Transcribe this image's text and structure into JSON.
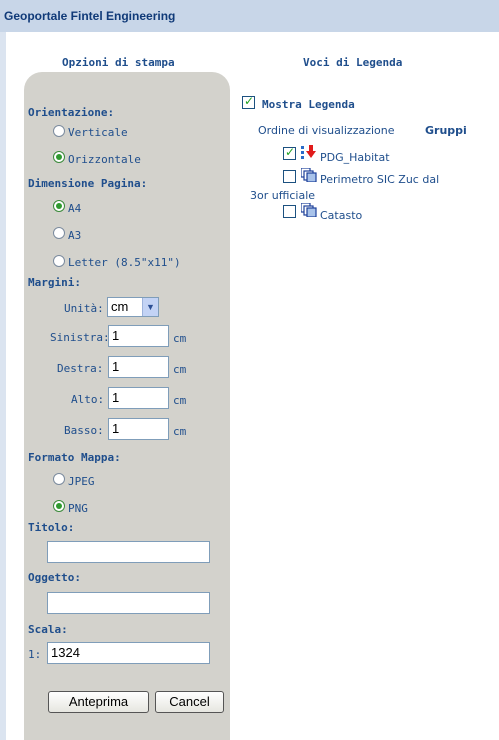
{
  "title": "Geoportale Fintel Engineering",
  "left_heading": "Opzioni di stampa",
  "right_heading": "Voci di Legenda",
  "orientation": {
    "label": "Orientazione:",
    "options": [
      "Verticale",
      "Orizzontale"
    ],
    "selected": "Orizzontale"
  },
  "page_size": {
    "label": "Dimensione Pagina:",
    "options": [
      "A4",
      "A3",
      "Letter (8.5\"x11\")"
    ],
    "selected": "A4"
  },
  "margins": {
    "label": "Margini:",
    "unit_label": "Unità:",
    "unit_value": "cm",
    "left_label": "Sinistra:",
    "left_value": "1",
    "right_label": "Destra:",
    "right_value": "1",
    "top_label": "Alto:",
    "top_value": "1",
    "bottom_label": "Basso:",
    "bottom_value": "1",
    "unit_suffix": "cm"
  },
  "map_format": {
    "label": "Formato Mappa:",
    "options": [
      "JPEG",
      "PNG"
    ],
    "selected": "PNG"
  },
  "title_field": {
    "label": "Titolo:",
    "value": ""
  },
  "subject_field": {
    "label": "Oggetto:",
    "value": ""
  },
  "scale_field": {
    "label": "Scala:",
    "prefix": "1:",
    "value": "1324"
  },
  "buttons": {
    "preview": "Anteprima",
    "cancel": "Cancel"
  },
  "legend": {
    "show_label": "Mostra Legenda",
    "show_checked": true,
    "order_label": "Ordine di visualizzazione",
    "groups_label": "Gruppi",
    "layers": [
      {
        "name": "PDG_Habitat",
        "checked": true,
        "icon": "red-arrow-icon"
      },
      {
        "name": "Perimetro SIC Zuc dal",
        "checked": false,
        "icon": "layer-stack-icon"
      },
      {
        "name": "Catasto",
        "checked": false,
        "icon": "layer-stack-icon"
      }
    ],
    "overflow_text": "3or ufficiale"
  },
  "colors": {
    "titlebar": "#c8d6e8",
    "panel": "#d3d2cc",
    "text": "#1f4e8c",
    "check": "#21a121"
  }
}
